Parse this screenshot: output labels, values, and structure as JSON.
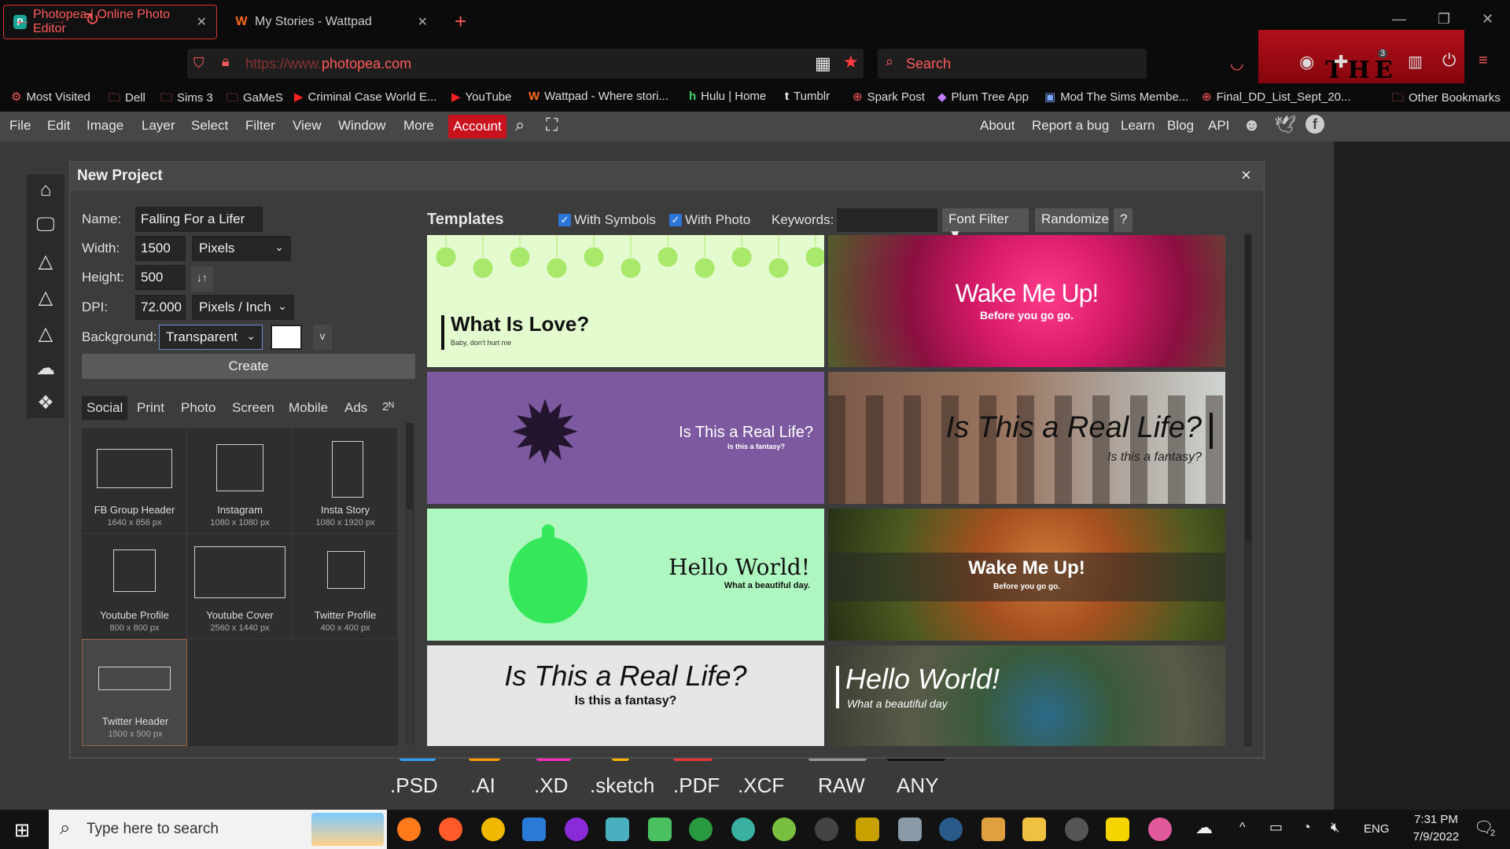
{
  "browser": {
    "tabs": [
      {
        "title": "Photopea | Online Photo Editor",
        "active": true
      },
      {
        "title": "My Stories - Wattpad",
        "active": false
      }
    ],
    "new_tab": "+",
    "url_prefix": "https://www.",
    "url_domain": "photopea.com",
    "search_placeholder": "Search",
    "theme_text": "THE BATMAN",
    "badge_count": "3",
    "bookmarks": [
      "Most Visited",
      "Dell",
      "Sims 3",
      "GaMeS",
      "Criminal Case World E...",
      "YouTube",
      "Wattpad - Where stori...",
      "Hulu | Home",
      "Tumblr",
      "Spark Post",
      "Plum Tree App",
      "Mod The Sims Membe...",
      "Final_DD_List_Sept_20...",
      "Other Bookmarks"
    ]
  },
  "menu": {
    "items": [
      "File",
      "Edit",
      "Image",
      "Layer",
      "Select",
      "Filter",
      "View",
      "Window",
      "More"
    ],
    "account": "Account",
    "right_items": [
      "About",
      "Report a bug",
      "Learn",
      "Blog",
      "API"
    ]
  },
  "formats": [
    ".PSD",
    ".AI",
    ".XD",
    ".sketch",
    ".PDF",
    ".XCF",
    "RAW",
    "ANY"
  ],
  "dialog": {
    "title": "New Project",
    "close": "×",
    "name_label": "Name:",
    "name_value": "Falling For a Lifer",
    "width_label": "Width:",
    "width_value": "1500",
    "width_unit": "Pixels",
    "height_label": "Height:",
    "height_value": "500",
    "dpi_label": "DPI:",
    "dpi_value": "72.000",
    "dpi_unit": "Pixels / Inch",
    "bg_label": "Background:",
    "bg_value": "Transparent",
    "bg_extra": "v",
    "swap": "↓↑",
    "create": "Create",
    "categories": [
      "Social",
      "Print",
      "Photo",
      "Screen",
      "Mobile",
      "Ads",
      "2ᴺ"
    ],
    "presets": [
      {
        "name": "FB Group Header",
        "size": "1640 x 856 px"
      },
      {
        "name": "Instagram",
        "size": "1080 x 1080 px"
      },
      {
        "name": "Insta Story",
        "size": "1080 x 1920 px"
      },
      {
        "name": "Youtube Profile",
        "size": "800 x 800 px"
      },
      {
        "name": "Youtube Cover",
        "size": "2560 x 1440 px"
      },
      {
        "name": "Twitter Profile",
        "size": "400 x 400 px"
      },
      {
        "name": "Twitter Header",
        "size": "1500 x 500 px"
      }
    ],
    "templates_title": "Templates",
    "with_symbols": "With Symbols",
    "with_photo": "With Photo",
    "keywords_label": "Keywords:",
    "font_filter": "Font Filter ▼",
    "randomize": "Randomize",
    "help": "?",
    "templates": [
      {
        "title": "What Is Love?",
        "sub": "Baby, don't hurt me"
      },
      {
        "title": "Wake Me Up!",
        "sub": "Before you go go."
      },
      {
        "title": "Is This a Real Life?",
        "sub": "Is this a fantasy?"
      },
      {
        "title": "Is This a Real Life?",
        "sub": "Is this a fantasy?"
      },
      {
        "title": "Hello World!",
        "sub": "What a beautiful day."
      },
      {
        "title": "Wake Me Up!",
        "sub": "Before you go go."
      },
      {
        "title": "Is This a Real Life?",
        "sub": "Is this a fantasy?"
      },
      {
        "title": "Hello World!",
        "sub": "What a beautiful day"
      }
    ]
  },
  "taskbar": {
    "search_placeholder": "Type here to search",
    "lang": "ENG",
    "time": "7:31 PM",
    "date": "7/9/2022",
    "notif_count": "2"
  }
}
